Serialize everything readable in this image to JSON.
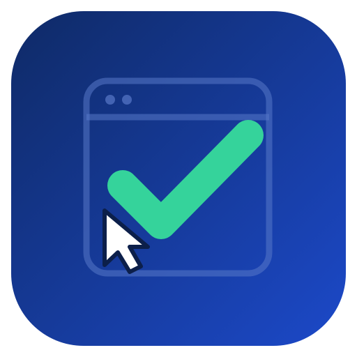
{
  "app_icon": {
    "name": "computer-use-verified",
    "colors": {
      "background_start": "#0f2a66",
      "background_end": "#1c49c9",
      "window_outline": "#5878c8",
      "check": "#35d39b",
      "cursor_fill": "#ffffff",
      "cursor_stroke": "#0c1f4a"
    },
    "icons": [
      "browser-window-icon",
      "checkmark-icon",
      "mouse-cursor-icon"
    ]
  }
}
